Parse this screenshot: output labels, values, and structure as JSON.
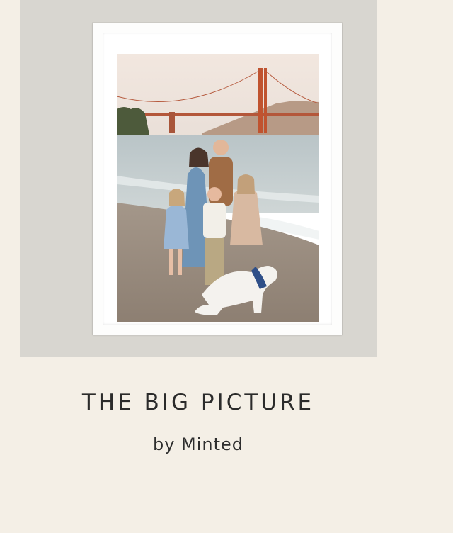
{
  "product": {
    "title": "THE BIG PICTURE",
    "byline": "by Minted"
  },
  "colors": {
    "page_background": "#f4efe6",
    "wall_background": "#d8d6d0",
    "frame_color": "#ffffff",
    "text_color": "#2b2b2b"
  }
}
